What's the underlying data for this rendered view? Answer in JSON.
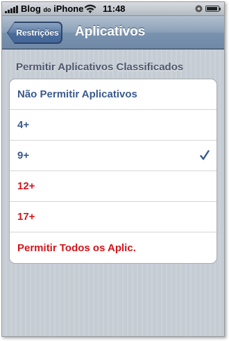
{
  "status_bar": {
    "carrier_main": "Blog",
    "carrier_small": "do",
    "carrier_end": "iPhone",
    "time": "11:48",
    "icons": [
      "signal-icon",
      "wifi-icon",
      "lock-icon",
      "battery-icon"
    ]
  },
  "nav": {
    "back_label": "Restrições",
    "title": "Aplicativos"
  },
  "section": {
    "header": "Permitir Aplicativos Classificados"
  },
  "options": [
    {
      "label": "Não Permitir Aplicativos",
      "color": "#3a5a8c",
      "checked": false
    },
    {
      "label": "4+",
      "color": "#3a5a8c",
      "checked": false
    },
    {
      "label": "9+",
      "color": "#3a5a8c",
      "checked": true
    },
    {
      "label": "12+",
      "color": "#d4151b",
      "checked": false
    },
    {
      "label": "17+",
      "color": "#d4151b",
      "checked": false
    },
    {
      "label": "Permitir Todos os Aplic.",
      "color": "#d4151b",
      "checked": false
    }
  ],
  "colors": {
    "nav_text": "#ffffff",
    "checkmark": "#3a5a8c",
    "allowed": "#3a5a8c",
    "restricted": "#d4151b"
  }
}
